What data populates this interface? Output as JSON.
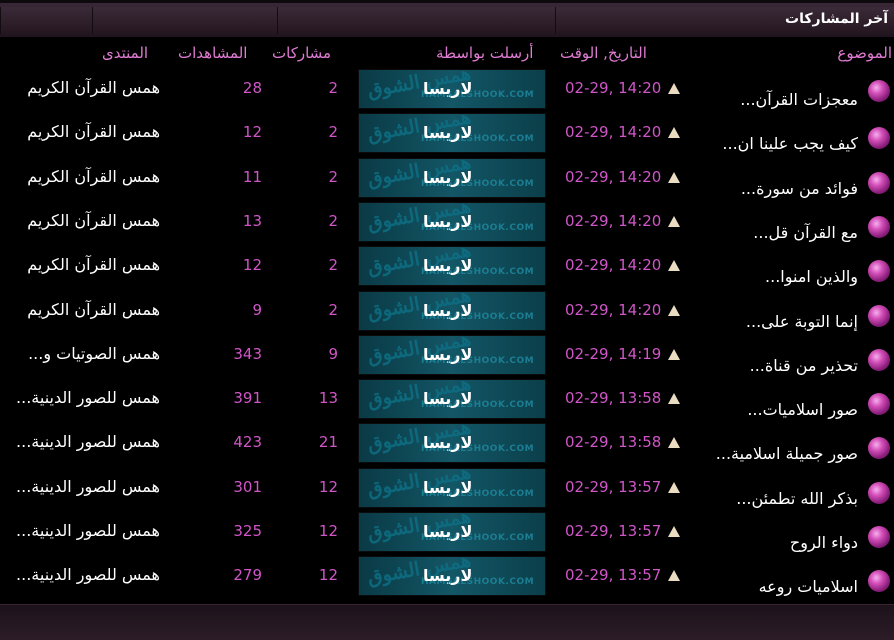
{
  "title": "آخر المشاركات",
  "headers": {
    "topic": "الموضوع",
    "datetime": "التاريخ, الوقت",
    "sent_by": "أرسلت بواسطة",
    "replies": "مشاركات",
    "views": "المشاهدات",
    "forum": "المنتدى"
  },
  "banner": {
    "watermark": "همس الشوق",
    "site": "HAMSALSHOOK.COM"
  },
  "rows": [
    {
      "topic": "معجزات القرآن...",
      "date": "02-29, 14:20",
      "author": "لاريسا",
      "replies": "2",
      "views": "28",
      "forum": "همس القرآن الكريم"
    },
    {
      "topic": "كيف يجب علينا ان...",
      "date": "02-29, 14:20",
      "author": "لاريسا",
      "replies": "2",
      "views": "12",
      "forum": "همس القرآن الكريم"
    },
    {
      "topic": "فوائد من سورة...",
      "date": "02-29, 14:20",
      "author": "لاريسا",
      "replies": "2",
      "views": "11",
      "forum": "همس القرآن الكريم"
    },
    {
      "topic": "مع القرآن قل...",
      "date": "02-29, 14:20",
      "author": "لاريسا",
      "replies": "2",
      "views": "13",
      "forum": "همس القرآن الكريم"
    },
    {
      "topic": "والذين امنوا...",
      "date": "02-29, 14:20",
      "author": "لاريسا",
      "replies": "2",
      "views": "12",
      "forum": "همس القرآن الكريم"
    },
    {
      "topic": "إنما التوبة على...",
      "date": "02-29, 14:20",
      "author": "لاريسا",
      "replies": "2",
      "views": "9",
      "forum": "همس القرآن الكريم"
    },
    {
      "topic": "تحذير من قناة...",
      "date": "02-29, 14:19",
      "author": "لاريسا",
      "replies": "9",
      "views": "343",
      "forum": "همس الصوتيات و..."
    },
    {
      "topic": "صور اسلاميات...",
      "date": "02-29, 13:58",
      "author": "لاريسا",
      "replies": "13",
      "views": "391",
      "forum": "همس للصور الدينية..."
    },
    {
      "topic": "صور جميلة اسلامية...",
      "date": "02-29, 13:58",
      "author": "لاريسا",
      "replies": "21",
      "views": "423",
      "forum": "همس للصور الدينية..."
    },
    {
      "topic": "بذكر الله تطمئن...",
      "date": "02-29, 13:57",
      "author": "لاريسا",
      "replies": "12",
      "views": "301",
      "forum": "همس للصور الدينية..."
    },
    {
      "topic": "دواء الروح",
      "date": "02-29, 13:57",
      "author": "لاريسا",
      "replies": "12",
      "views": "325",
      "forum": "همس للصور الدينية..."
    },
    {
      "topic": "اسلاميات روعه",
      "date": "02-29, 13:57",
      "author": "لاريسا",
      "replies": "12",
      "views": "279",
      "forum": "همس للصور الدينية..."
    }
  ]
}
